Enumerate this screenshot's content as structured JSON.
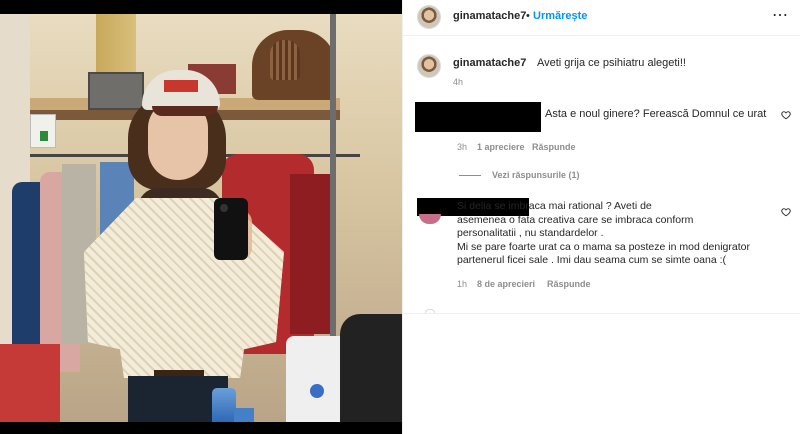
{
  "post": {
    "username": "ginamatache7",
    "dot": "•",
    "follow_label": "Urmărește",
    "more_icon": "⋯",
    "icon": "more-horizontal-icon"
  },
  "caption": {
    "username": "ginamatache7",
    "text": "Aveti grija ce psihiatru alegeti!!",
    "time": "4h"
  },
  "comments": [
    {
      "text": "Asta e noul ginere? Ferească Domnul ce urat",
      "time": "3h",
      "likes": "1 apreciere",
      "reply_label": "Răspunde",
      "heart_icon": "heart-icon",
      "view_replies_label": "Vezi răspunsurile (1)"
    },
    {
      "lines": [
        "Si delia se imbraca mai rational ? Aveti de",
        "asemenea o fata creativa care se imbraca conform",
        "personalitatii , nu standardelor .",
        "Mi se pare foarte urat ca o mama sa posteze in mod denigrator",
        "partenerul ficei sale . Imi dau seama cum se simte oana :("
      ],
      "time": "1h",
      "likes": "8 de aprecieri",
      "reply_label": "Răspunde",
      "heart_icon": "heart-icon"
    }
  ],
  "colors": {
    "accent": "#0095f6",
    "text": "#262626",
    "secondary": "#8e8e8e",
    "redaction": "#000000"
  }
}
